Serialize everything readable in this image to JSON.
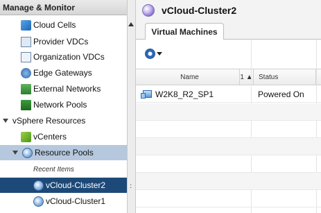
{
  "left_panel": {
    "header": "Manage & Monitor",
    "items": [
      {
        "label": "Cloud Cells",
        "icon": "cloud-cells-icon"
      },
      {
        "label": "Provider VDCs",
        "icon": "provider-vdc-icon"
      },
      {
        "label": "Organization VDCs",
        "icon": "organization-vdc-icon"
      },
      {
        "label": "Edge Gateways",
        "icon": "edge-gateway-icon"
      },
      {
        "label": "External Networks",
        "icon": "external-network-icon"
      },
      {
        "label": "Network Pools",
        "icon": "network-pool-icon"
      }
    ],
    "vsphere": {
      "label": "vSphere Resources",
      "vcenters": "vCenters",
      "resource_pools": "Resource Pools",
      "recent_items": "Recent Items",
      "recent": [
        {
          "label": "vCloud-Cluster2",
          "selected": true
        },
        {
          "label": "vCloud-Cluster1",
          "selected": false
        }
      ]
    }
  },
  "right_panel": {
    "title": "vCloud-Cluster2",
    "tab": "Virtual Machines",
    "toolbar": {
      "gear_icon": "gear-icon"
    },
    "grid": {
      "columns": [
        "Name",
        "1 ▲",
        "Status"
      ],
      "rows": [
        {
          "name": "W2K8_R2_SP1",
          "status": "Powered On"
        }
      ]
    }
  },
  "colors": {
    "selected_dark": "#1d4978",
    "selected_light": "#b6c8dd"
  }
}
